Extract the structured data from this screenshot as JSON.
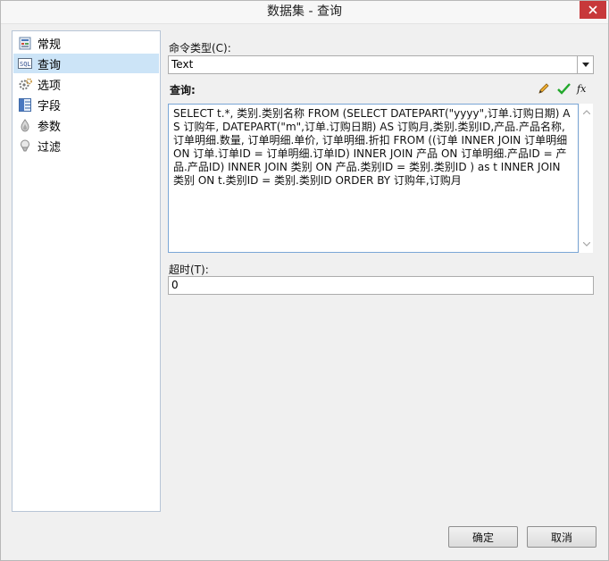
{
  "window": {
    "title": "数据集 - 查询",
    "close_icon": "close-icon"
  },
  "nav": {
    "items": [
      {
        "label": "常规",
        "icon": "general-icon"
      },
      {
        "label": "查询",
        "icon": "query-icon",
        "selected": true
      },
      {
        "label": "选项",
        "icon": "options-icon"
      },
      {
        "label": "字段",
        "icon": "fields-icon"
      },
      {
        "label": "参数",
        "icon": "parameters-icon"
      },
      {
        "label": "过滤",
        "icon": "filter-icon"
      }
    ]
  },
  "command_type": {
    "label": "命令类型(C):",
    "value": "Text"
  },
  "query": {
    "label": "查询:",
    "toolbar": [
      "edit-pencil-icon",
      "validate-check-icon",
      "expression-fx-icon"
    ],
    "text": "SELECT t.*, 类别.类别名称 FROM (SELECT DATEPART(\"yyyy\",订单.订购日期) AS 订购年, DATEPART(\"m\",订单.订购日期) AS 订购月,类别.类别ID,产品.产品名称,订单明细.数量, 订单明细.单价, 订单明细.折扣 FROM ((订单  INNER JOIN 订单明细 ON 订单.订单ID = 订单明细.订单ID) INNER JOIN 产品 ON 订单明细.产品ID = 产品.产品ID) INNER JOIN 类别 ON 产品.类别ID = 类别.类别ID ) as t INNER JOIN 类别 ON t.类别ID = 类别.类别ID ORDER BY 订购年,订购月"
  },
  "timeout": {
    "label": "超时(T):",
    "value": "0"
  },
  "buttons": {
    "ok": "确定",
    "cancel": "取消"
  }
}
